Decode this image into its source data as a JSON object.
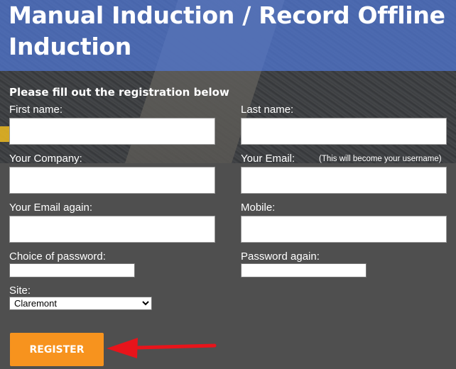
{
  "page": {
    "title": "Manual Induction / Record Offline Induction",
    "subtitle": "Please fill out the registration below"
  },
  "form": {
    "first_name_label": "First name:",
    "last_name_label": "Last name:",
    "company_label": "Your Company:",
    "email_label": "Your Email:",
    "email_note": "(This will become your username)",
    "email_again_label": "Your Email again:",
    "mobile_label": "Mobile:",
    "password_label": "Choice of password:",
    "password_again_label": "Password again:",
    "site_label": "Site:",
    "site_selected": "Claremont",
    "register_label": "REGISTER",
    "first_name_value": "",
    "last_name_value": "",
    "company_value": "",
    "email_value": "",
    "email_again_value": "",
    "mobile_value": "",
    "password_value": "",
    "password_again_value": ""
  },
  "colors": {
    "header_blue": "#4567b5",
    "background": "#4f4f4f",
    "button": "#f7931e",
    "arrow": "#e8141b"
  },
  "annotation": {
    "icon": "red-arrow-icon"
  }
}
